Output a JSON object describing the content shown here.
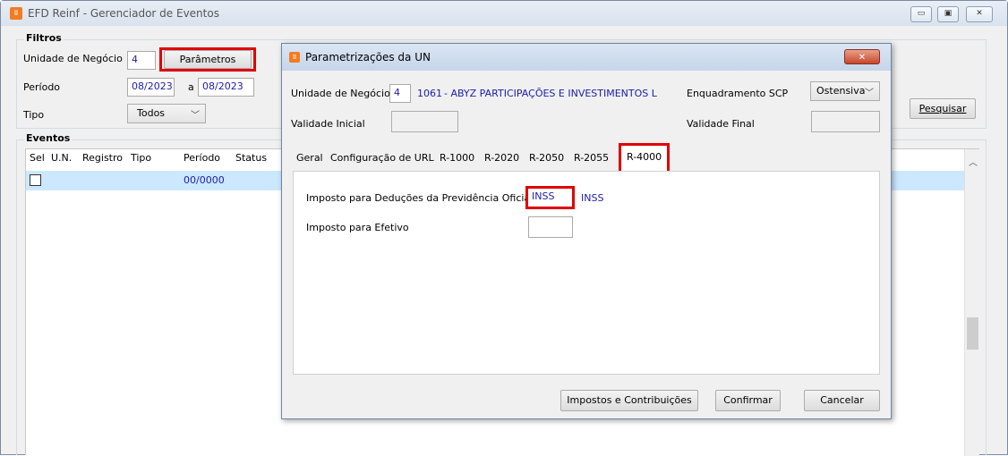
{
  "main_window": {
    "title": "EFD Reinf - Gerenciador de Eventos",
    "controls": {
      "minimize": "▭",
      "restore": "▣",
      "close": "✕"
    }
  },
  "filters": {
    "legend": "Filtros",
    "unidade_label": "Unidade de Negócio",
    "unidade_value": "4",
    "parametros_button": "Parâmetros",
    "periodo_label": "Período",
    "periodo_from": "08/2023",
    "periodo_sep": "a",
    "periodo_to": "08/2023",
    "tipo_label": "Tipo",
    "tipo_value": "Todos",
    "pesquisar_button": "Pesquisar"
  },
  "eventos": {
    "legend": "Eventos",
    "columns": [
      "Sel",
      "U.N.",
      "Registro",
      "Tipo",
      "Período",
      "Status"
    ],
    "rows": [
      {
        "sel": "",
        "un": "",
        "registro": "",
        "tipo": "",
        "periodo": "00/0000",
        "status": ""
      }
    ]
  },
  "dialog": {
    "title": "Parametrizações da UN",
    "close": "✕",
    "unidade_label": "Unidade de Negócio",
    "unidade_value": "4",
    "unidade_code": "1061",
    "unidade_name": "- ABYZ PARTICIPAÇÕES E INVESTIMENTOS L",
    "enquadramento_label": "Enquadramento SCP",
    "enquadramento_value": "Ostensiva",
    "validade_inicial_label": "Validade Inicial",
    "validade_final_label": "Validade Final",
    "tabs": [
      "Geral",
      "Configuração de URL",
      "R-1000",
      "R-2020",
      "R-2050",
      "R-2055",
      "R-4000"
    ],
    "active_tab": "R-4000",
    "imposto_deducoes_label": "Imposto para Deduções da Previdência Oficial",
    "imposto_deducoes_value": "INSS",
    "imposto_deducoes_desc": "INSS",
    "imposto_efetivo_label": "Imposto para Efetivo",
    "imposto_efetivo_value": "",
    "buttons": {
      "impostos": "Impostos e Contribuições",
      "confirmar": "Confirmar",
      "cancelar": "Cancelar"
    }
  },
  "colors": {
    "selection_row": "#cce8ff",
    "title_accent": "#3b7ecf",
    "highlight_red": "#e00000",
    "value_text": "#1c1ca8"
  }
}
